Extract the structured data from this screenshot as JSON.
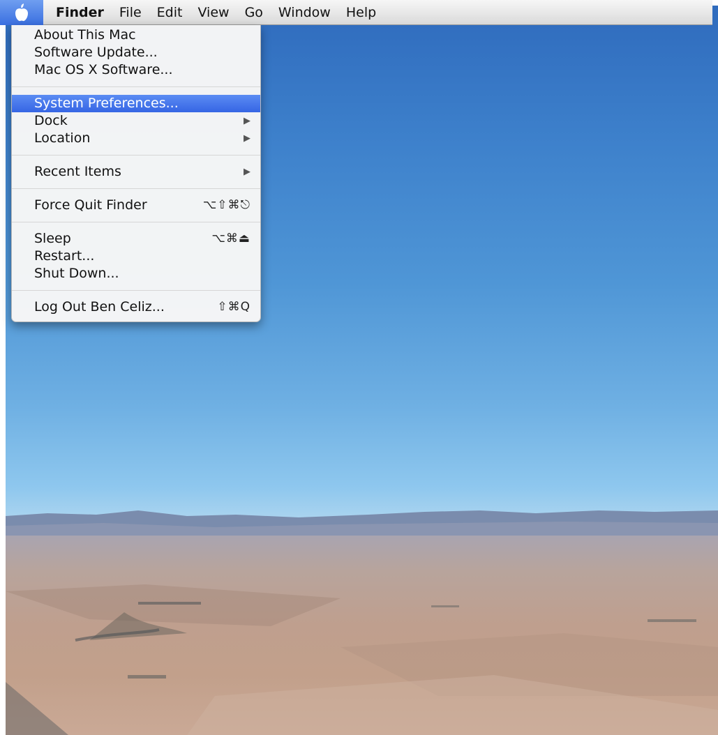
{
  "menubar": {
    "apple_icon": "apple-logo-icon",
    "items": [
      "Finder",
      "File",
      "Edit",
      "View",
      "Go",
      "Window",
      "Help"
    ]
  },
  "apple_menu": {
    "about": "About This Mac",
    "software_update": "Software Update...",
    "mac_os_x_software": "Mac OS X Software...",
    "system_preferences": "System Preferences...",
    "dock": "Dock",
    "location": "Location",
    "recent_items": "Recent Items",
    "force_quit": "Force Quit Finder",
    "force_quit_shortcut": "⌥⇧⌘⎋",
    "sleep": "Sleep",
    "sleep_shortcut": "⌥⌘⏏",
    "restart": "Restart...",
    "shut_down": "Shut Down...",
    "log_out": "Log Out Ben Celiz...",
    "log_out_shortcut": "⇧⌘Q",
    "submenu_arrow": "▶"
  },
  "colors": {
    "highlight": "#3a6ce6",
    "sky_top": "#2f6bbd",
    "sky_bottom": "#a8d3ef"
  }
}
